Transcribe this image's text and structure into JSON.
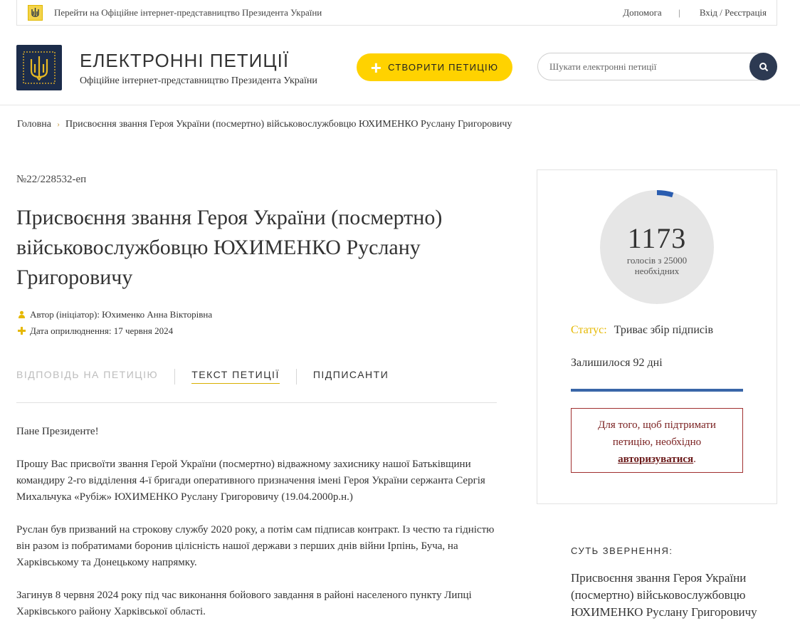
{
  "topbar": {
    "link_text": "Перейти на Офіційне інтернет-представництво Президента України",
    "help": "Допомога",
    "login": "Вхід / Реєстрація"
  },
  "header": {
    "title": "ЕЛЕКТРОННІ ПЕТИЦІЇ",
    "subtitle": "Офіційне інтернет-представництво Президента України",
    "create_button": "СТВОРИТИ ПЕТИЦІЮ",
    "search_placeholder": "Шукати електронні петиції"
  },
  "breadcrumb": {
    "home": "Головна",
    "current": "Присвоєння звання Героя України (посмертно) військовослужбовцю ЮХИМЕНКО Руслану Григоровичу"
  },
  "petition": {
    "number": "№22/228532-еп",
    "title": "Присвоєння звання Героя України (посмертно) військовослужбовцю ЮХИМЕНКО Руслану Григоровичу",
    "author": "Автор (ініціатор): Юхименко Анна Вікторівна",
    "date": "Дата оприлюднення: 17 червня 2024"
  },
  "tabs": {
    "answer": "ВІДПОВІДЬ НА ПЕТИЦІЮ",
    "text": "ТЕКСТ ПЕТИЦІЇ",
    "signers": "ПІДПИСАНТИ"
  },
  "body": {
    "p1": "Пане Президенте!",
    "p2": "Прошу Вас присвоїти звання Герой України (посмертно) відважному захиснику нашої Батьківщини командиру 2-го відділення 4-ї бригади оперативного призначення імені Героя України сержанта Сергія Михальчука «Рубіж» ЮХИМЕНКО Руслану Григоровичу (19.04.2000р.н.)",
    "p3": "Руслан був призваний на строкову службу 2020 року, а потім сам підписав контракт. Із честю та гідністю він разом із побратимами боронив цілісність нашої держави з перших днів війни Ірпінь, Буча, на Харківському та Донецькому напрямку.",
    "p4": "Загинув 8 червня 2024 року під час виконання бойового завдання в районі населеного пункту Липці Харківського району Харківської області."
  },
  "sidebar": {
    "votes": "1173",
    "votes_label": "голосів з 25000 необхідних",
    "votes_current": 1173,
    "votes_required": 25000,
    "status_label": "Статус:",
    "status_value": "Триває збір підписів",
    "remaining": "Залишилося 92 дні",
    "auth_text": "Для того, щоб підтримати петицію, необхідно",
    "auth_link": "авторизуватися",
    "auth_end": "."
  },
  "essence": {
    "heading": "СУТЬ ЗВЕРНЕННЯ:",
    "text": "Присвоєння звання Героя України (посмертно) військовослужбовцю ЮХИМЕНКО Руслану Григоровичу"
  },
  "colors": {
    "accent": "#ffd200",
    "navy": "#2d3a52",
    "progress": "#3a66a8",
    "alert": "#a03030"
  }
}
